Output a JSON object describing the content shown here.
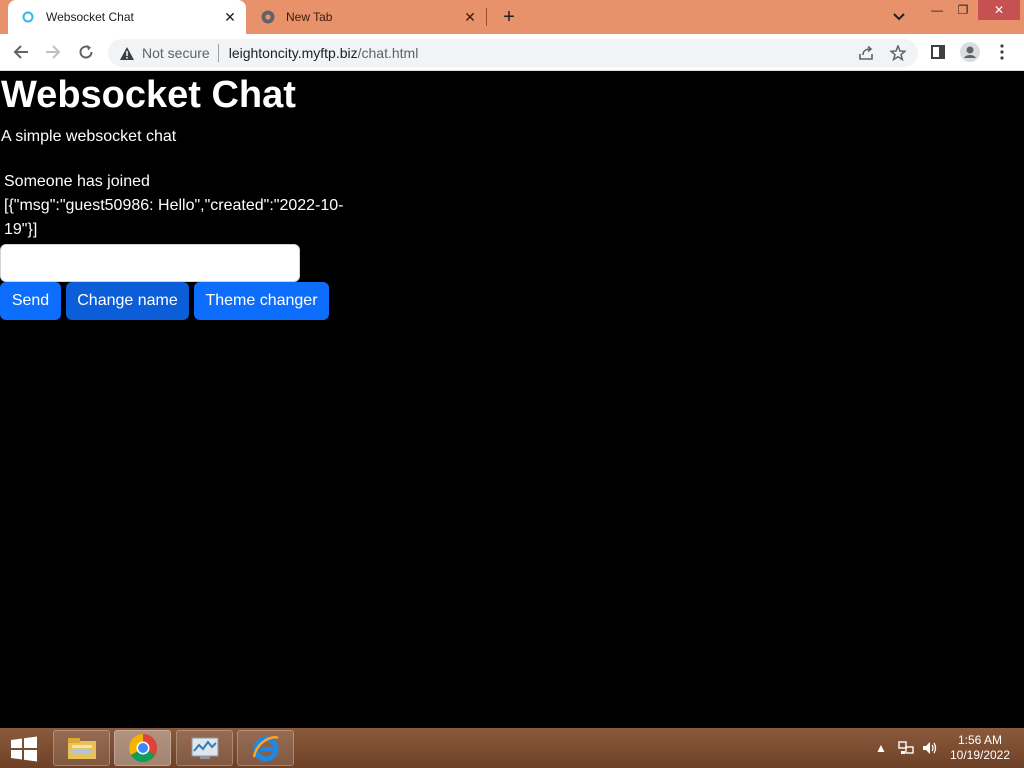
{
  "browser": {
    "tabs": [
      {
        "title": "Websocket Chat",
        "active": true
      },
      {
        "title": "New Tab",
        "active": false
      }
    ],
    "address": {
      "security_label": "Not secure",
      "host": "leightoncity.myftp.biz",
      "path": "/chat.html"
    }
  },
  "page": {
    "heading": "Websocket Chat",
    "subtitle": "A simple websocket chat",
    "messages": [
      "Someone has joined",
      "[{\"msg\":\"guest50986: Hello\",\"created\":\"2022-10-19\"}]"
    ],
    "input": {
      "value": "",
      "placeholder": ""
    },
    "buttons": {
      "send": "Send",
      "change_name": "Change name",
      "theme_changer": "Theme changer"
    }
  },
  "taskbar": {
    "clock_time": "1:56 AM",
    "clock_date": "10/19/2022"
  },
  "colors": {
    "tabstrip": "#e8926b",
    "primary_button": "#0d6efd",
    "page_bg": "#000000"
  }
}
